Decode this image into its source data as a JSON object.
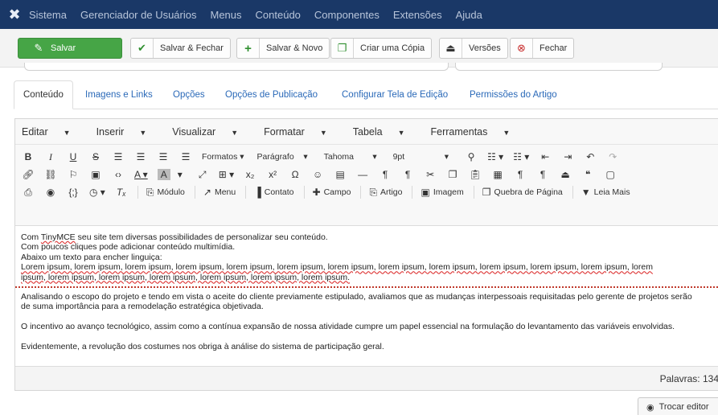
{
  "navbar": {
    "logo_icon": "joomla-logo-icon",
    "items": [
      "Sistema",
      "Gerenciador de Usuários",
      "Menus",
      "Conteúdo",
      "Componentes",
      "Extensões",
      "Ajuda"
    ]
  },
  "toolbar": {
    "save": "Salvar",
    "save_close": "Salvar & Fechar",
    "save_new": "Salvar & Novo",
    "save_copy": "Criar uma Cópia",
    "versions": "Versões",
    "close": "Fechar",
    "colors": {
      "save_bg": "#46a546",
      "close_icon": "#c82b2b",
      "check_icon": "#2f8f2f"
    }
  },
  "tabs": [
    "Conteúdo",
    "Imagens e Links",
    "Opções",
    "Opções de Publicação",
    "Configurar Tela de Edição",
    "Permissões do Artigo"
  ],
  "editor": {
    "menubar": [
      "Editar",
      "Inserir",
      "Visualizar",
      "Formatar",
      "Tabela",
      "Ferramentas"
    ],
    "formats_label": "Formatos",
    "block_format": "Parágrafo",
    "font_family": "Tahoma",
    "font_size": "9pt",
    "plugins": {
      "module": "Módulo",
      "menu": "Menu",
      "contact": "Contato",
      "field": "Campo",
      "article": "Artigo",
      "image": "Imagem",
      "pagebreak": "Quebra de Página",
      "readmore": "Leia Mais"
    },
    "content": {
      "line1_pre": "Com ",
      "line1_link": "TinyMCE",
      "line1_post": " seu site tem diversas possibilidades de personalizar seu conteúdo.",
      "line2": "Com poucos cliques pode adicionar conteúdo multimídia.",
      "line3": "Abaixo um texto para encher linguiça:",
      "lorem_line1": "Lorem ipsum, lorem ipsum, lorem ipsum, lorem ipsum, lorem ipsum, lorem ipsum, lorem ipsum, lorem ipsum, lorem ipsum, lorem ipsum, lorem ipsum, lorem ipsum, lorem",
      "lorem_line2": "ipsum, lorem ipsum, lorem ipsum, lorem ipsum, lorem ipsum, lorem ipsum, lorem ipsum.",
      "para1_line1": "Analisando o escopo do projeto e tendo em vista o aceite do cliente previamente estipulado, avaliamos que as mudanças interpessoais requisitadas pelo gerente de projetos serão",
      "para1_line2": "de suma importância para a remodelação estratégica objetivada.",
      "para2": "O incentivo ao avanço tecnológico, assim como a contínua expansão de nossa atividade cumpre um papel essencial na formulação do levantamento das variáveis envolvidas.",
      "para3": "Evidentemente, a revolução dos costumes nos obriga à análise do sistema de participação geral."
    },
    "word_count": "Palavras: 134"
  },
  "toggle_editor": "Trocar editor"
}
